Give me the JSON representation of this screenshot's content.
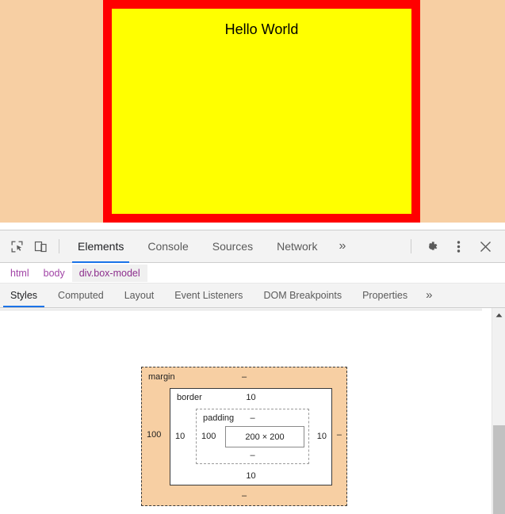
{
  "page_preview": {
    "heading_text": "Hello World",
    "colors": {
      "body_background": "#f7cfa3",
      "element_border": "#ff0000",
      "element_background": "#ffff00"
    }
  },
  "devtools": {
    "toolbar": {
      "inspect_icon": "inspect-element-icon",
      "device_toolbar_icon": "device-toolbar-icon",
      "tabs": [
        {
          "label": "Elements",
          "active": true
        },
        {
          "label": "Console",
          "active": false
        },
        {
          "label": "Sources",
          "active": false
        },
        {
          "label": "Network",
          "active": false
        }
      ],
      "more_tabs_label": "»",
      "settings_icon": "gear-icon",
      "main_menu_icon": "kebab-menu-icon",
      "close_label": "✕"
    },
    "breadcrumb": {
      "items": [
        {
          "label": "html",
          "selected": false
        },
        {
          "label": "body",
          "selected": false
        },
        {
          "label": "div.box-model",
          "selected": true
        }
      ]
    },
    "sidebar_tabs": {
      "items": [
        {
          "label": "Styles",
          "active": true
        },
        {
          "label": "Computed",
          "active": false
        },
        {
          "label": "Layout",
          "active": false
        },
        {
          "label": "Event Listeners",
          "active": false
        },
        {
          "label": "DOM Breakpoints",
          "active": false
        },
        {
          "label": "Properties",
          "active": false
        }
      ],
      "more_label": "»"
    },
    "box_model": {
      "margin": {
        "label": "margin",
        "top": "–",
        "right": "–",
        "bottom": "–",
        "left": "100"
      },
      "border": {
        "label": "border",
        "top": "10",
        "right": "10",
        "bottom": "10",
        "left": "10"
      },
      "padding": {
        "label": "padding",
        "top": "–",
        "right": "–",
        "bottom": "–",
        "left": "100"
      },
      "content": {
        "size": "200 × 200"
      },
      "colors": {
        "margin_fill": "#f7cfa3",
        "border_fill": "#ffffff",
        "padding_fill": "#ffffff",
        "content_fill": "#ffffff"
      }
    },
    "scrollbar": {
      "up_arrow": "scroll-up-arrow-icon"
    }
  }
}
